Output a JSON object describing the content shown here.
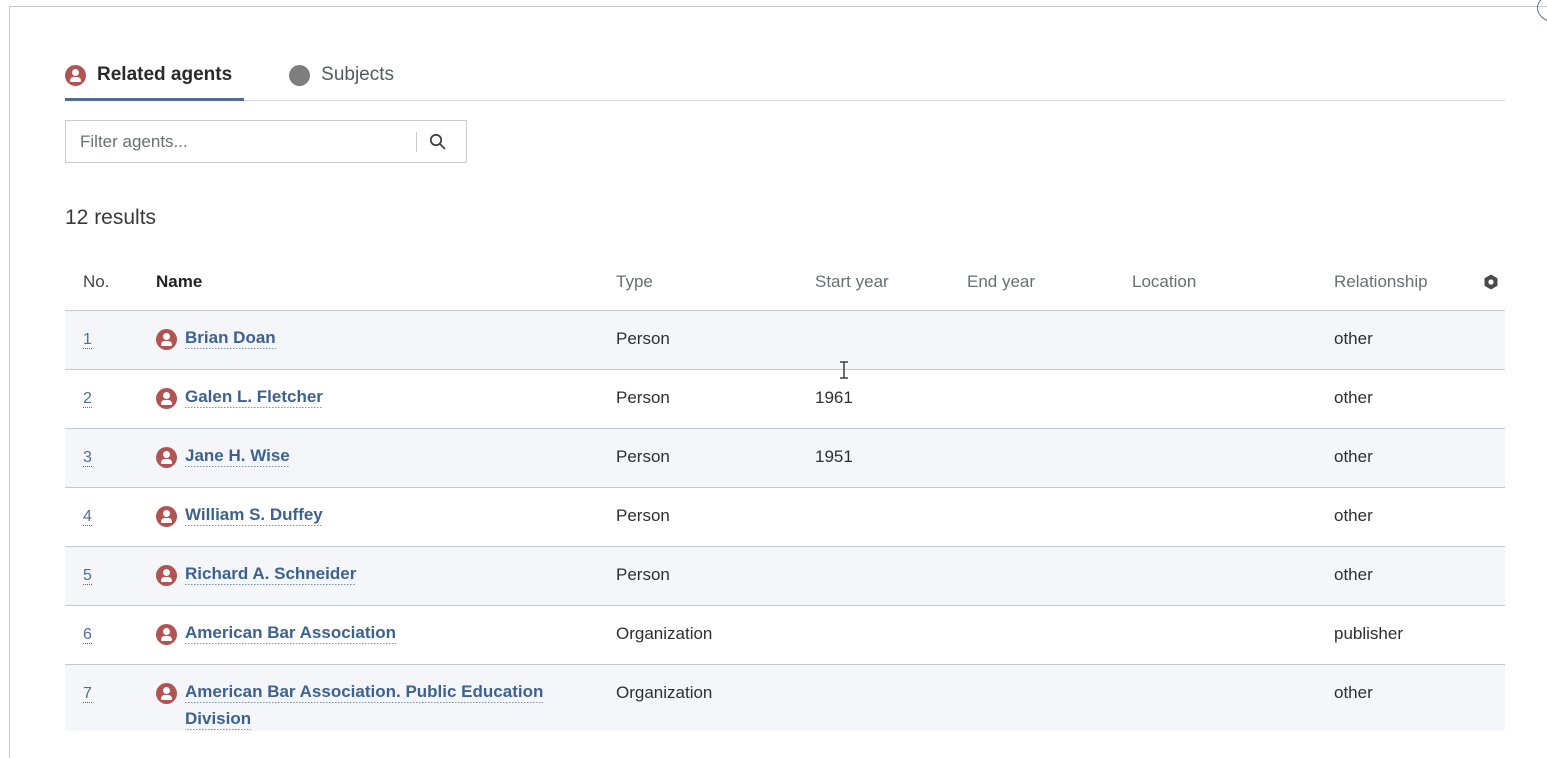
{
  "tabs": [
    {
      "label": "Related agents",
      "active": true,
      "icon": "person-icon"
    },
    {
      "label": "Subjects",
      "active": false,
      "icon": "subject-icon"
    }
  ],
  "filter": {
    "placeholder": "Filter agents..."
  },
  "results_label": "12 results",
  "table": {
    "headers": {
      "no": "No.",
      "name": "Name",
      "type": "Type",
      "start_year": "Start year",
      "end_year": "End year",
      "location": "Location",
      "relationship": "Relationship"
    },
    "rows": [
      {
        "no": "1",
        "name": "Brian Doan",
        "type": "Person",
        "start_year": "",
        "end_year": "",
        "location": "",
        "relationship": "other"
      },
      {
        "no": "2",
        "name": "Galen L. Fletcher",
        "type": "Person",
        "start_year": "1961",
        "end_year": "",
        "location": "",
        "relationship": "other"
      },
      {
        "no": "3",
        "name": "Jane H. Wise",
        "type": "Person",
        "start_year": "1951",
        "end_year": "",
        "location": "",
        "relationship": "other"
      },
      {
        "no": "4",
        "name": "William S. Duffey",
        "type": "Person",
        "start_year": "",
        "end_year": "",
        "location": "",
        "relationship": "other"
      },
      {
        "no": "5",
        "name": "Richard A. Schneider",
        "type": "Person",
        "start_year": "",
        "end_year": "",
        "location": "",
        "relationship": "other"
      },
      {
        "no": "6",
        "name": "American Bar Association",
        "type": "Organization",
        "start_year": "",
        "end_year": "",
        "location": "",
        "relationship": "publisher"
      },
      {
        "no": "7",
        "name": "American Bar Association. Public Education Division",
        "type": "Organization",
        "start_year": "",
        "end_year": "",
        "location": "",
        "relationship": "other"
      }
    ]
  },
  "colors": {
    "accent": "#4f6e94",
    "agent_icon": "#b15353",
    "subject_icon": "#7e7e7e",
    "row_alt": "#f4f6fa"
  }
}
